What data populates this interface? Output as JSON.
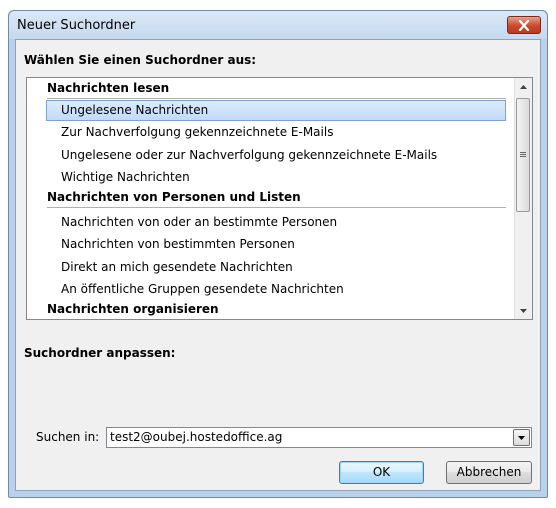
{
  "window": {
    "title": "Neuer Suchordner"
  },
  "heading_select": "Wählen Sie einen Suchordner aus:",
  "groups": [
    {
      "header": "Nachrichten lesen",
      "items": [
        {
          "label": "Ungelesene Nachrichten",
          "selected": true
        },
        {
          "label": "Zur Nachverfolgung gekennzeichnete E-Mails"
        },
        {
          "label": "Ungelesene oder zur Nachverfolgung gekennzeichnete E-Mails"
        },
        {
          "label": "Wichtige Nachrichten"
        }
      ]
    },
    {
      "header": "Nachrichten von Personen und Listen",
      "items": [
        {
          "label": "Nachrichten von oder an bestimmte Personen"
        },
        {
          "label": "Nachrichten von bestimmten Personen"
        },
        {
          "label": "Direkt an mich gesendete Nachrichten"
        },
        {
          "label": "An öffentliche Gruppen gesendete Nachrichten"
        }
      ]
    },
    {
      "header": "Nachrichten organisieren",
      "items": []
    }
  ],
  "heading_customize": "Suchordner anpassen:",
  "search_in": {
    "label": "Suchen in:",
    "value": "test2@oubej.hostedoffice.ag"
  },
  "buttons": {
    "ok": "OK",
    "cancel": "Abbrechen"
  },
  "icons": {
    "close": "close-icon",
    "scroll_up": "scroll-up-arrow-icon",
    "scroll_down": "scroll-down-arrow-icon",
    "dropdown": "chevron-down-icon"
  },
  "colors": {
    "selection": "#c1dbfc",
    "close_button": "#c94a2f",
    "frame": "#b9d1ea"
  }
}
